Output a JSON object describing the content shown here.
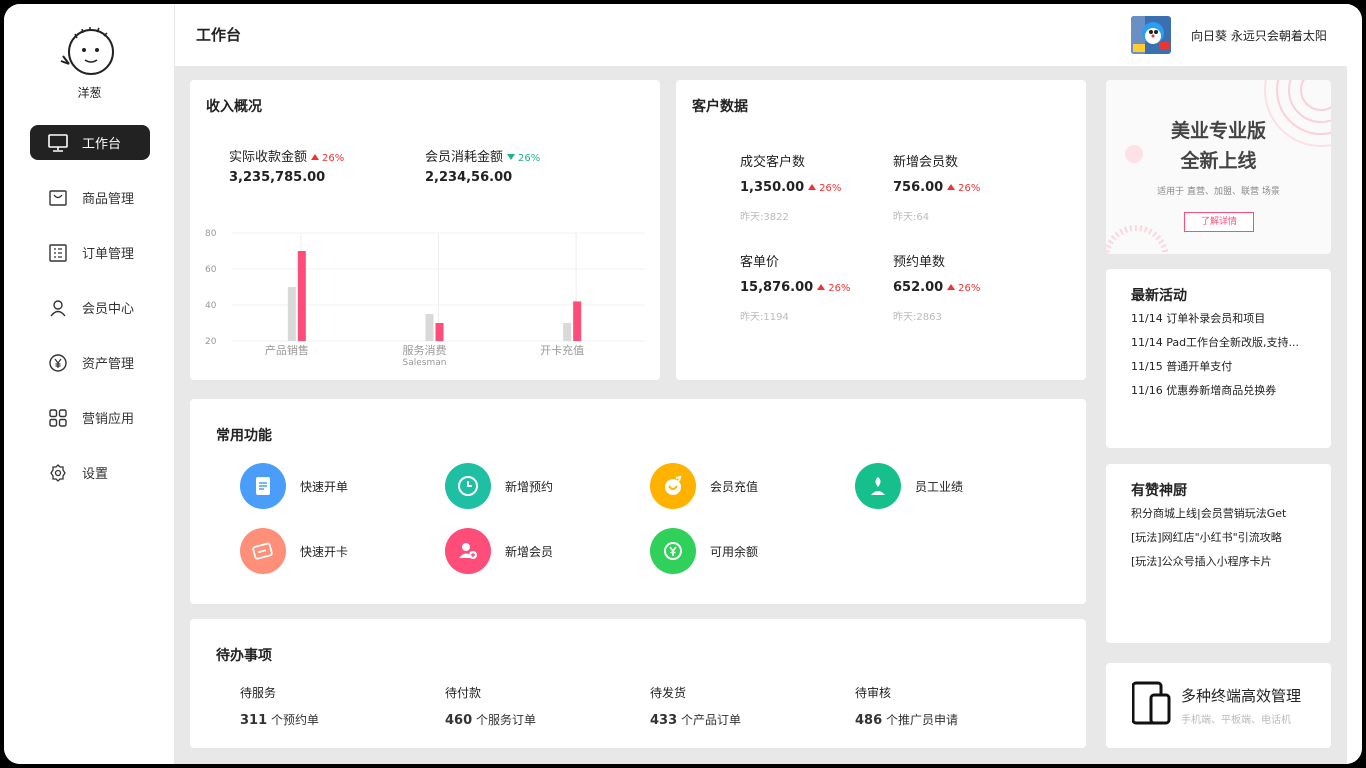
{
  "sidebar": {
    "username": "洋葱",
    "items": [
      {
        "label": "工作台",
        "icon": "monitor-icon",
        "active": true
      },
      {
        "label": "商品管理",
        "icon": "bag-icon"
      },
      {
        "label": "订单管理",
        "icon": "order-list-icon"
      },
      {
        "label": "会员中心",
        "icon": "user-icon"
      },
      {
        "label": "资产管理",
        "icon": "yen-coin-icon"
      },
      {
        "label": "营销应用",
        "icon": "grid-apps-icon"
      },
      {
        "label": "设置",
        "icon": "gear-icon"
      }
    ]
  },
  "header": {
    "title": "工作台",
    "motto": "向日葵 永远只会朝着太阳"
  },
  "income": {
    "title": "收入概况",
    "stats": [
      {
        "label": "实际收款金额",
        "value": "3,235,785.00",
        "trend": "up",
        "pct": "26%"
      },
      {
        "label": "会员消耗金额",
        "value": "2,234,56.00",
        "trend": "down",
        "pct": "26%"
      }
    ]
  },
  "chart_data": {
    "type": "bar",
    "categories": [
      "产品销售",
      "服务消费",
      "开卡充值"
    ],
    "series": [
      {
        "values": [
          50,
          35,
          30
        ],
        "color": "#d9d9d9"
      },
      {
        "values": [
          70,
          30,
          42
        ],
        "color": "#ff4d7a"
      }
    ],
    "yticks": [
      "80",
      "60",
      "40",
      "20"
    ],
    "ylim": [
      20,
      80
    ],
    "xsublabel": "Salesman",
    "grid": true
  },
  "customer": {
    "title": "客户数据",
    "stats": [
      {
        "label": "成交客户数",
        "value": "1,350.00",
        "pct": "26%",
        "sub": "昨天:3822"
      },
      {
        "label": "新增会员数",
        "value": "756.00",
        "pct": "26%",
        "sub": "昨天:64"
      },
      {
        "label": "客单价",
        "value": "15,876.00",
        "pct": "26%",
        "sub": "昨天:1194"
      },
      {
        "label": "预约单数",
        "value": "652.00",
        "pct": "26%",
        "sub": "昨天:2863"
      }
    ]
  },
  "functions": {
    "title": "常用功能",
    "items": [
      {
        "label": "快速开单",
        "color": "#4a9df8",
        "icon": "document-icon"
      },
      {
        "label": "新增预约",
        "color": "#1ebfa3",
        "icon": "clock-icon"
      },
      {
        "label": "会员充值",
        "color": "#ffb300",
        "icon": "heart-coin-icon"
      },
      {
        "label": "员工业绩",
        "color": "#16c08c",
        "icon": "staff-icon"
      },
      {
        "label": "快速开卡",
        "color": "#ff8f78",
        "icon": "card-icon"
      },
      {
        "label": "新增会员",
        "color": "#ff4d7a",
        "icon": "add-member-icon"
      },
      {
        "label": "可用余额",
        "color": "#2fd15a",
        "icon": "yen-icon"
      }
    ]
  },
  "todo": {
    "title": "待办事项",
    "items": [
      {
        "label": "待服务",
        "count": "311",
        "unit": "个预约单"
      },
      {
        "label": "待付款",
        "count": "460",
        "unit": "个服务订单"
      },
      {
        "label": "待发货",
        "count": "433",
        "unit": "个产品订单"
      },
      {
        "label": "待审核",
        "count": "486",
        "unit": "个推广员申请"
      }
    ]
  },
  "banner": {
    "line1": "美业专业版",
    "line2": "全新上线",
    "sub": "适用于 直营、加盟、联营 场景",
    "button": "了解详情",
    "accent": "#ff4d7a"
  },
  "activities": {
    "title": "最新活动",
    "items": [
      "11/14 订单补录会员和项目",
      "11/14 Pad工作台全新改版,支持...",
      "11/15 普通开单支付",
      "11/16 优惠券新增商品兑换券"
    ]
  },
  "chef": {
    "title": "有赞神厨",
    "items": [
      "积分商城上线|会员营销玩法Get",
      "[玩法]网红店\"小红书\"引流攻略",
      "[玩法]公众号插入小程序卡片"
    ]
  },
  "terminal": {
    "title": "多种终端高效管理",
    "sub": "手机端、平板端、电话机"
  }
}
